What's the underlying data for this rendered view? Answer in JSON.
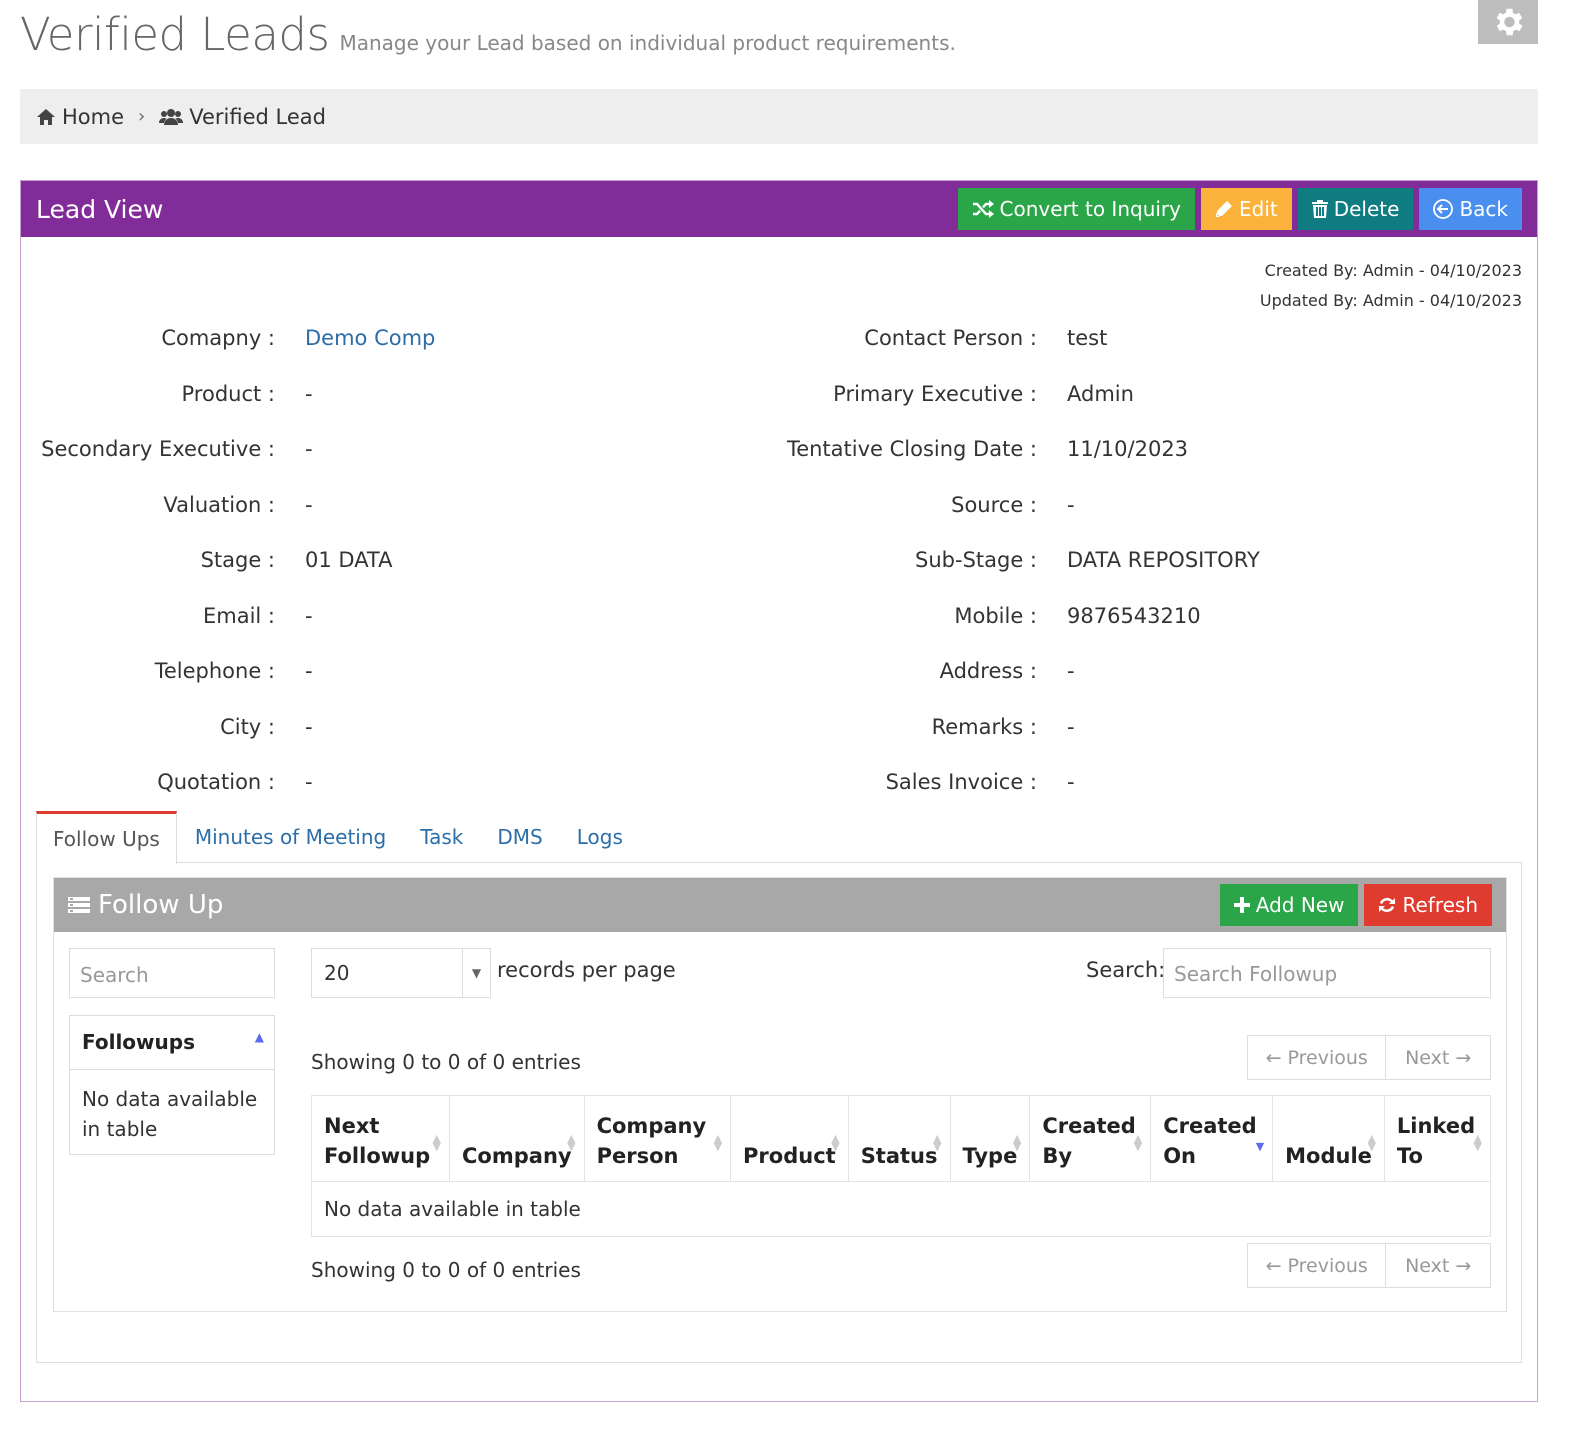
{
  "header": {
    "title": "Verified Leads",
    "subtitle": "Manage your Lead based on individual product requirements."
  },
  "breadcrumb": {
    "home": "Home",
    "current": "Verified Lead"
  },
  "panel": {
    "title": "Lead View",
    "buttons": {
      "convert": "Convert to Inquiry",
      "edit": "Edit",
      "delete": "Delete",
      "back": "Back"
    },
    "created_by": "Created By: Admin - 04/10/2023",
    "updated_by": "Updated By: Admin - 04/10/2023"
  },
  "fields": {
    "company": {
      "label": "Comapny :",
      "value": "Demo Comp"
    },
    "contact_person": {
      "label": "Contact Person :",
      "value": "test"
    },
    "product": {
      "label": "Product :",
      "value": "-"
    },
    "primary_executive": {
      "label": "Primary Executive :",
      "value": "Admin"
    },
    "secondary_executive": {
      "label": "Secondary Executive :",
      "value": "-"
    },
    "tentative_closing_date": {
      "label": "Tentative Closing Date :",
      "value": "11/10/2023"
    },
    "valuation": {
      "label": "Valuation :",
      "value": "-"
    },
    "source": {
      "label": "Source :",
      "value": "-"
    },
    "stage": {
      "label": "Stage :",
      "value": "01 DATA"
    },
    "sub_stage": {
      "label": "Sub-Stage :",
      "value": "DATA REPOSITORY"
    },
    "email": {
      "label": "Email :",
      "value": "-"
    },
    "mobile": {
      "label": "Mobile :",
      "value": "9876543210"
    },
    "telephone": {
      "label": "Telephone :",
      "value": "-"
    },
    "address": {
      "label": "Address :",
      "value": "-"
    },
    "city": {
      "label": "City :",
      "value": "-"
    },
    "remarks": {
      "label": "Remarks :",
      "value": "-"
    },
    "quotation": {
      "label": "Quotation :",
      "value": "-"
    },
    "sales_invoice": {
      "label": "Sales Invoice :",
      "value": "-"
    }
  },
  "tabs": [
    "Follow Ups",
    "Minutes of Meeting",
    "Task",
    "DMS",
    "Logs"
  ],
  "followup": {
    "title": "Follow Up",
    "add_new": "Add New",
    "refresh": "Refresh",
    "side_search_placeholder": "Search",
    "side_header": "Followups",
    "side_empty": "No data available in table",
    "page_length": "20",
    "records_per_page": "records per page",
    "search_label": "Search:",
    "search_placeholder": "Search Followup",
    "info": "Showing 0 to 0 of 0 entries",
    "previous": "← Previous",
    "next": "Next →",
    "columns": [
      "Next Followup",
      "Company",
      "Company Person",
      "Product",
      "Status",
      "Type",
      "Created By",
      "Created On",
      "Module",
      "Linked To"
    ],
    "empty": "No data available in table"
  },
  "colors": {
    "panel_header": "#822c9a",
    "convert": "#2aa548",
    "edit": "#fbb23b",
    "delete": "#0f7c82",
    "back": "#4a8ff0",
    "refresh": "#e03b2f"
  }
}
